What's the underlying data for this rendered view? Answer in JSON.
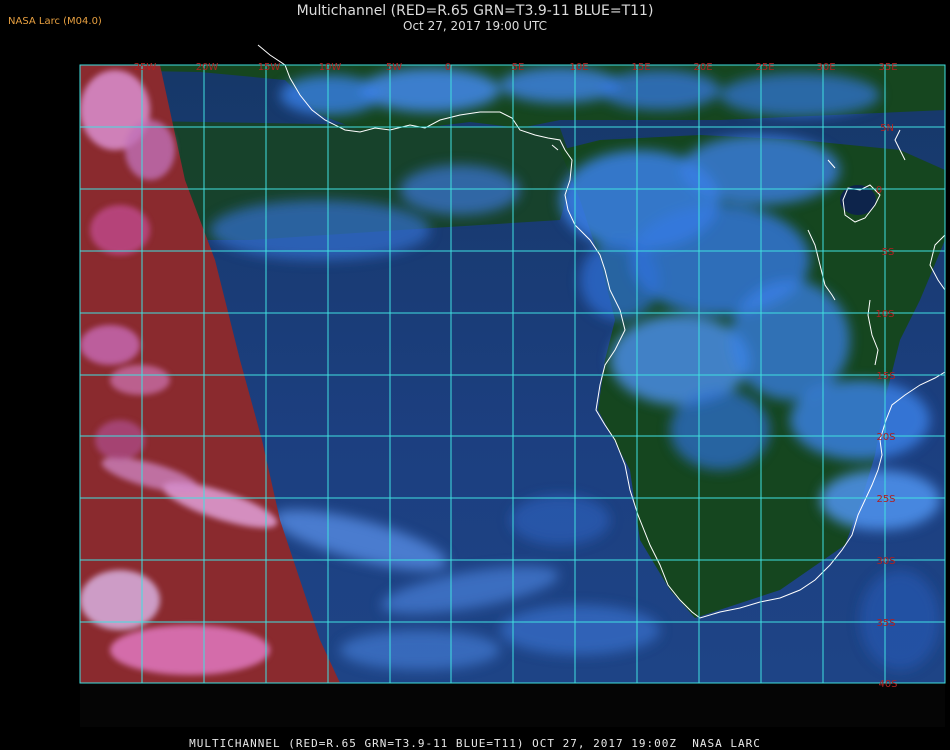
{
  "header": {
    "source": "NASA Larc (M04.0)",
    "title": "Multichannel (RED=R.65 GRN=T3.9-11 BLUE=T11)",
    "datetime": "Oct 27, 2017 19:00 UTC"
  },
  "footer": {
    "caption": "MULTICHANNEL (RED=R.65 GRN=T3.9-11 BLUE=T11) OCT 27, 2017 19:00Z  NASA LARC"
  },
  "map": {
    "lon_labels": [
      "25W",
      "20W",
      "15W",
      "10W",
      "5W",
      "0",
      "5E",
      "10E",
      "15E",
      "20E",
      "25E",
      "30E",
      "35E"
    ],
    "lat_labels": [
      "5N",
      "0",
      "5S",
      "10S",
      "15S",
      "20S",
      "25S",
      "30S",
      "35S",
      "40S"
    ],
    "colors": {
      "grid": "#40e0e0",
      "coastline": "#ffffff",
      "labels": "#b02020",
      "ocean": "#1a3a78",
      "land": "#164a22",
      "cloud": "#3a7ee0",
      "day_edge": "#c04060"
    }
  }
}
